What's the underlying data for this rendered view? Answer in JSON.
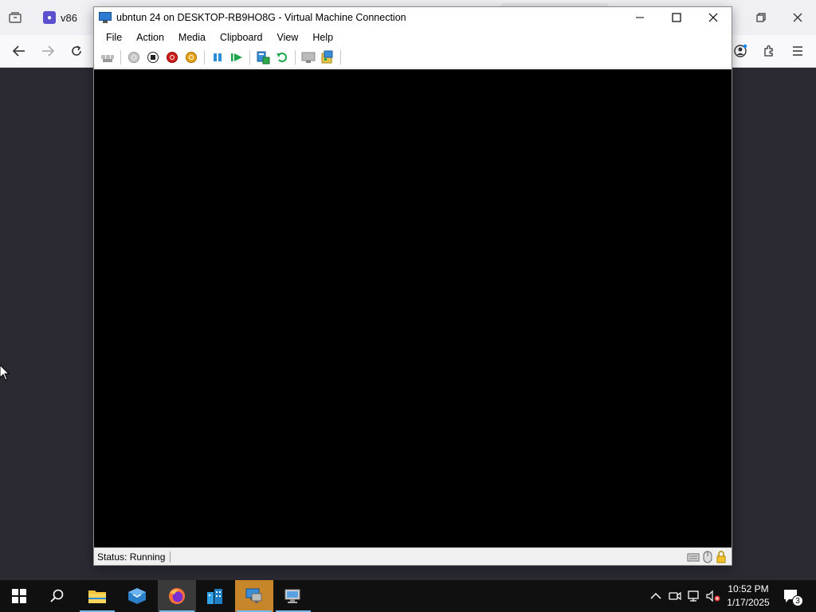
{
  "browser": {
    "tab_label": "v86",
    "tab_icon": "v86-favicon-icon"
  },
  "vm_window": {
    "title": "ubntun 24 on DESKTOP-RB9HO8G - Virtual Machine Connection",
    "menu": [
      "File",
      "Action",
      "Media",
      "Clipboard",
      "View",
      "Help"
    ],
    "toolbar_icons": [
      "ctrl-alt-del-icon",
      "start-icon",
      "turn-off-icon",
      "shutdown-icon",
      "save-icon",
      "pause-icon",
      "resume-icon",
      "checkpoint-icon",
      "revert-icon",
      "enhanced-session-icon",
      "share-icon"
    ],
    "status": "Status: Running",
    "screen_color": "#000000"
  },
  "taskbar": {
    "time": "10:52 PM",
    "date": "1/17/2025",
    "notification_count": "3"
  },
  "colors": {
    "taskbar_bg": "#101010",
    "accent": "#76b9ed",
    "highlight": "#c8862a"
  }
}
